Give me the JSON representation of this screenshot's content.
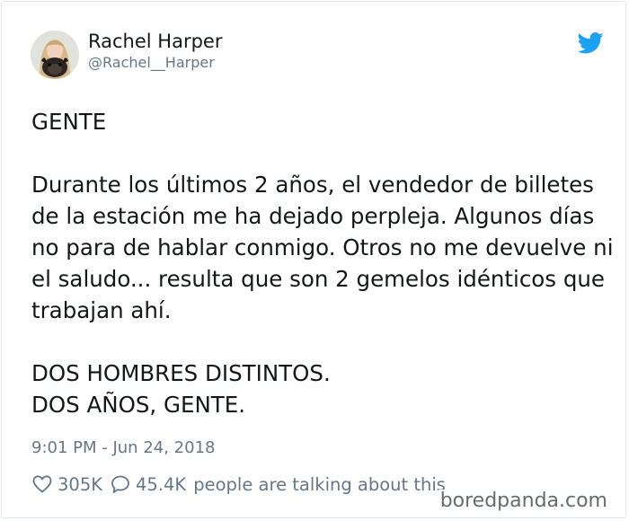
{
  "author": {
    "name": "Rachel Harper",
    "handle": "@Rachel__Harper",
    "avatar_icon": "avatar-woman-with-pug"
  },
  "platform_icon": "twitter-bird-icon",
  "brand_color": "#1da1f2",
  "tweet": {
    "paragraphs": [
      [
        "GENTE"
      ],
      [
        "Durante los últimos 2 años, el vendedor de billetes",
        "de la estación me ha dejado perpleja. Algunos días",
        "no para de hablar conmigo. Otros no me devuelve ni",
        "el saludo... resulta que son 2 gemelos idénticos que",
        "trabajan ahí."
      ],
      [
        "DOS HOMBRES DISTINTOS.",
        "DOS AÑOS, GENTE."
      ]
    ],
    "timestamp": "9:01 PM - Jun 24, 2018"
  },
  "engagement": {
    "likes": "305K",
    "replies": "45.4K",
    "talking_text": "people are talking about this"
  },
  "watermark": "boredpanda.com"
}
